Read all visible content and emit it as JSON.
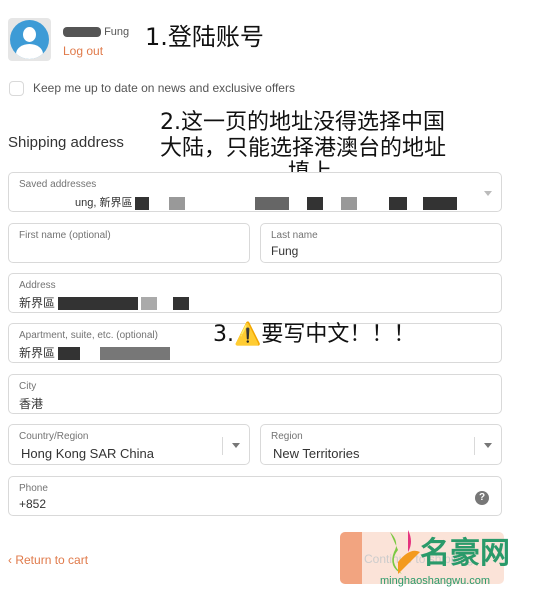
{
  "header": {
    "user_name_suffix": "Fung",
    "logout": "Log out",
    "annotation": "1.登陆账号"
  },
  "newsletter": {
    "label": "Keep me up to date on news and exclusive offers",
    "checked": false
  },
  "shipping": {
    "title": "Shipping address",
    "annotation_line1": "2.这一页的地址没得选择中国",
    "annotation_line2": "大陆，只能选择港澳台的地址",
    "annotation_line3": "填上"
  },
  "fields": {
    "saved": {
      "label": "Saved addresses",
      "value": "ung, 新界區"
    },
    "first_name": {
      "label": "First name (optional)",
      "value": ""
    },
    "last_name": {
      "label": "Last name",
      "value": "Fung"
    },
    "address": {
      "label": "Address",
      "value": "新界區"
    },
    "apartment": {
      "label": "Apartment, suite, etc. (optional)",
      "value": "新界區"
    },
    "city": {
      "label": "City",
      "value": "香港"
    },
    "country": {
      "label": "Country/Region",
      "value": "Hong Kong SAR China"
    },
    "region": {
      "label": "Region",
      "value": "New Territories"
    },
    "phone": {
      "label": "Phone",
      "value": "+852"
    }
  },
  "annotation3": "3.⚠️要写中文！！！",
  "footer": {
    "return": "Return to cart",
    "continue": "Continue to shipping"
  },
  "watermark": {
    "text": "名豪网",
    "url": "minghaoshangwu.com"
  },
  "colors": {
    "accent": "#e07a4a",
    "avatar": "#3d9bd6"
  }
}
